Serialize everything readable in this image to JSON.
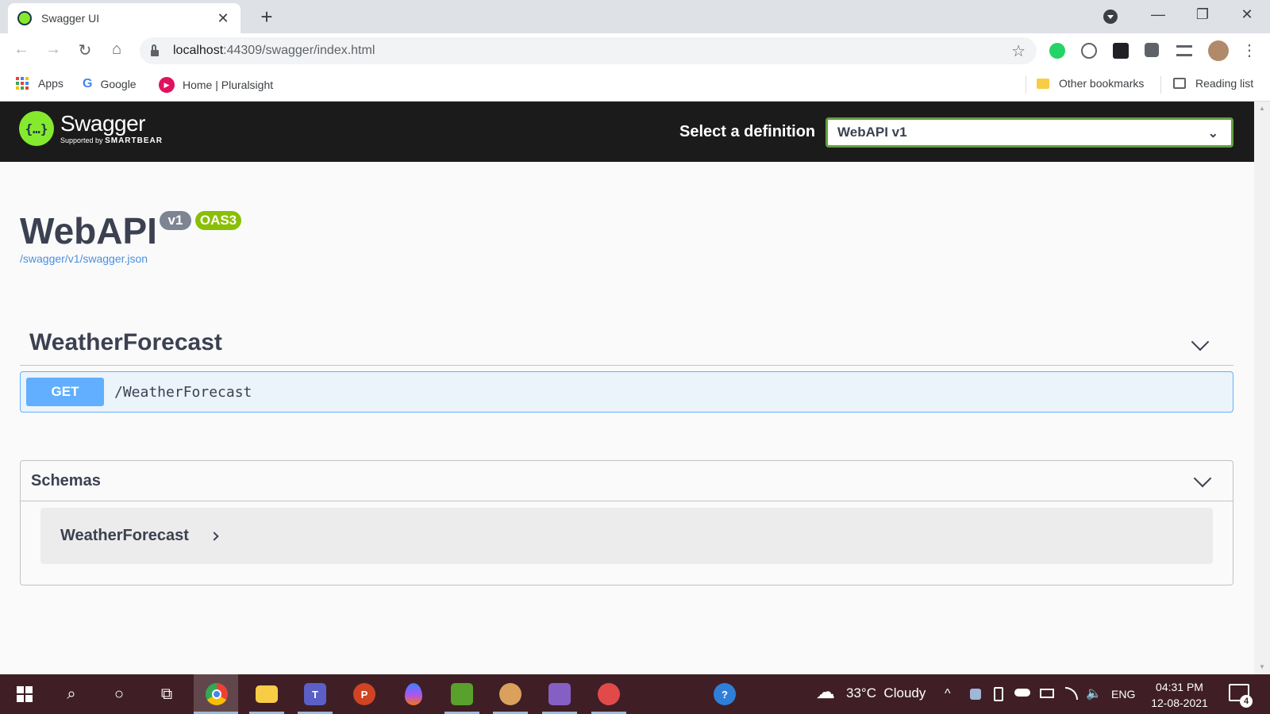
{
  "browser": {
    "tab": {
      "title": "Swagger UI",
      "close_glyph": "✕"
    },
    "new_tab_glyph": "+",
    "window": {
      "minimize_glyph": "—",
      "restore_glyph": "❐",
      "close_glyph": "✕"
    },
    "nav": {
      "back_glyph": "←",
      "forward_glyph": "→",
      "reload_glyph": "↻",
      "home_glyph": "⌂"
    },
    "url": {
      "host": "localhost",
      "path": ":44309/swagger/index.html"
    },
    "star_glyph": "☆",
    "menu_glyph": "⋮",
    "extensions": [
      {
        "name": "whatsapp-icon",
        "color": "#25d366"
      },
      {
        "name": "swagger-extension-icon",
        "color": "#5f6368"
      },
      {
        "name": "react-devtools-icon",
        "color": "#202124"
      },
      {
        "name": "puzzle-extensions-icon",
        "color": "#5f6368"
      },
      {
        "name": "media-queue-icon",
        "color": "#5f6368"
      },
      {
        "name": "profile-avatar-icon",
        "color": "#b08a6a"
      }
    ],
    "bookmarks": {
      "apps": "Apps",
      "google": "Google",
      "google_glyph": "G",
      "pluralsight": "Home | Pluralsight",
      "pluralsight_glyph": "▶",
      "other": "Other bookmarks",
      "reading": "Reading list"
    }
  },
  "swagger": {
    "brand": {
      "name": "Swagger",
      "sub_prefix": "Supported by",
      "sub_brand": "SMARTBEAR",
      "logo_glyph": "{…}"
    },
    "definition": {
      "label": "Select a definition",
      "selected": "WebAPI v1",
      "caret": "⌄"
    },
    "info": {
      "title": "WebAPI",
      "version_badge": "v1",
      "oas_badge": "OAS3",
      "spec_link": "/swagger/v1/swagger.json"
    },
    "tags": [
      {
        "name": "WeatherForecast",
        "operations": [
          {
            "method": "GET",
            "path": "/WeatherForecast"
          }
        ]
      }
    ],
    "schemas": {
      "title": "Schemas",
      "items": [
        {
          "name": "WeatherForecast"
        }
      ]
    }
  },
  "taskbar": {
    "search_glyph": "⌕",
    "cortana_glyph": "○",
    "taskview_glyph": "⧉",
    "apps": [
      {
        "name": "chrome-icon",
        "label": "",
        "color": "#4285f4"
      },
      {
        "name": "file-explorer-icon",
        "label": "",
        "color": "#f9cc46"
      },
      {
        "name": "teams-icon",
        "label": "T",
        "color": "#5b5fc7"
      },
      {
        "name": "powerpoint-icon",
        "label": "P",
        "color": "#d04423"
      },
      {
        "name": "drop-app-icon",
        "label": "",
        "color": "#a855f7"
      },
      {
        "name": "notepad-app-icon",
        "label": "",
        "color": "#5aa02c"
      },
      {
        "name": "paint-icon",
        "label": "",
        "color": "#d9a15b"
      },
      {
        "name": "visual-studio-icon",
        "label": "",
        "color": "#865fc5"
      },
      {
        "name": "snipping-tool-icon",
        "label": "",
        "color": "#e24a4a"
      },
      {
        "name": "help-icon",
        "label": "?",
        "color": "#2f7fd8"
      }
    ],
    "weather": {
      "text": "33°C  Cloudy",
      "glyph": "☁"
    },
    "tray": {
      "chevron_glyph": "^",
      "language": "ENG",
      "volume_glyph": "🔈"
    },
    "clock": {
      "time": "04:31 PM",
      "date": "12-08-2021"
    },
    "notifications": {
      "count": "4"
    }
  }
}
